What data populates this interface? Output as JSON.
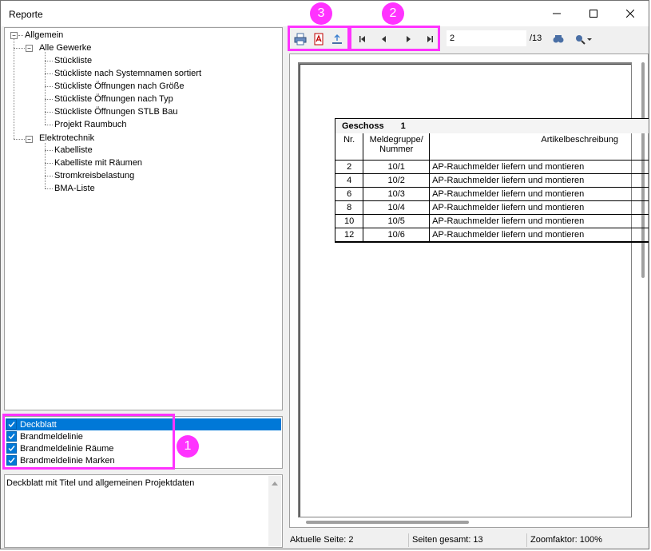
{
  "window": {
    "title": "Reporte"
  },
  "tree": {
    "root": "Allgemein",
    "groups": [
      {
        "label": "Alle Gewerke",
        "items": [
          "Stückliste",
          "Stückliste nach Systemnamen sortiert",
          "Stückliste Öffnungen nach Größe",
          "Stückliste Öffnungen nach Typ",
          "Stückliste Öffnungen STLB Bau",
          "Projekt Raumbuch"
        ]
      },
      {
        "label": "Elektrotechnik",
        "items": [
          "Kabelliste",
          "Kabelliste mit Räumen",
          "Stromkreisbelastung",
          "BMA-Liste"
        ]
      }
    ]
  },
  "checklist": [
    {
      "label": "Deckblatt",
      "checked": true,
      "selected": true
    },
    {
      "label": "Brandmeldelinie",
      "checked": true,
      "selected": false
    },
    {
      "label": "Brandmeldelinie Räume",
      "checked": true,
      "selected": false
    },
    {
      "label": "Brandmeldelinie Marken",
      "checked": true,
      "selected": false
    }
  ],
  "description": "Deckblatt mit Titel und allgemeinen Projektdaten",
  "toolbar": {
    "page_value": "2",
    "page_total": "/13",
    "icons": [
      "print-icon",
      "pdf-icon",
      "export-icon",
      "first-page-icon",
      "prev-page-icon",
      "next-page-icon",
      "last-page-icon",
      "search-icon",
      "zoom-icon"
    ]
  },
  "report": {
    "header_label": "Geschoss",
    "header_value": "1",
    "col_nr": "Nr.",
    "col_meldegruppe_1": "Meldegruppe/",
    "col_meldegruppe_2": "Nummer",
    "col_artikel": "Artikelbeschreibung",
    "rows": [
      {
        "nr": "2",
        "mg": "10/1",
        "art": "AP-Rauchmelder liefern und montieren"
      },
      {
        "nr": "4",
        "mg": "10/2",
        "art": "AP-Rauchmelder liefern und montieren"
      },
      {
        "nr": "6",
        "mg": "10/3",
        "art": "AP-Rauchmelder liefern und montieren"
      },
      {
        "nr": "8",
        "mg": "10/4",
        "art": "AP-Rauchmelder liefern und montieren"
      },
      {
        "nr": "10",
        "mg": "10/5",
        "art": "AP-Rauchmelder liefern und montieren"
      },
      {
        "nr": "12",
        "mg": "10/6",
        "art": "AP-Rauchmelder liefern und montieren"
      }
    ]
  },
  "status": {
    "current_page": "Aktuelle Seite: 2",
    "total_pages": "Seiten gesamt: 13",
    "zoom": "Zoomfaktor: 100%"
  },
  "callouts": [
    "1",
    "2",
    "3"
  ],
  "colors": {
    "highlight": "#ff33ff",
    "selection": "#0078d7"
  }
}
